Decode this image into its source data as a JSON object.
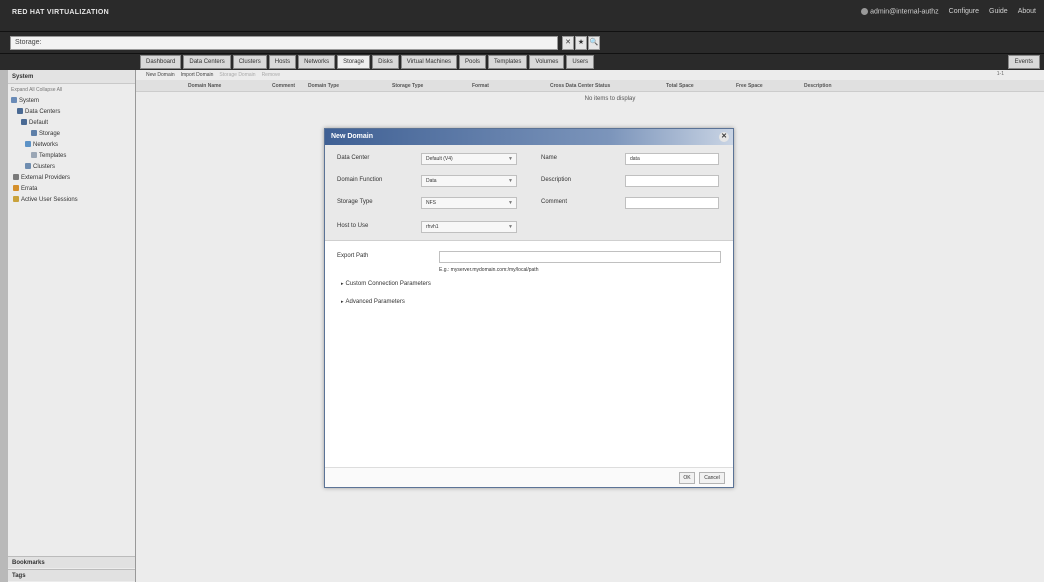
{
  "app": {
    "brand": "RED HAT VIRTUALIZATION",
    "user_label": "admin@internal-authz",
    "top_links": [
      "Configure",
      "Guide",
      "About"
    ]
  },
  "search": {
    "value": "Storage:",
    "buttons": [
      "✕",
      "★",
      "🔍"
    ]
  },
  "tabs": [
    {
      "label": "Dashboard",
      "active": false
    },
    {
      "label": "Data Centers",
      "active": false
    },
    {
      "label": "Clusters",
      "active": false
    },
    {
      "label": "Hosts",
      "active": false
    },
    {
      "label": "Networks",
      "active": false
    },
    {
      "label": "Storage",
      "active": true
    },
    {
      "label": "Disks",
      "active": false
    },
    {
      "label": "Virtual Machines",
      "active": false
    },
    {
      "label": "Pools",
      "active": false
    },
    {
      "label": "Templates",
      "active": false
    },
    {
      "label": "Volumes",
      "active": false
    },
    {
      "label": "Users",
      "active": false
    }
  ],
  "events_tab": "Events",
  "sidebar": {
    "title": "System",
    "expand_all": "Expand All",
    "collapse_all": "Collapse All",
    "tree": [
      {
        "label": "System",
        "icon": "globe-icon"
      },
      {
        "label": "Data Centers",
        "icon": "datacenter-icon"
      },
      {
        "label": "Default",
        "icon": "datacenter-icon"
      },
      {
        "label": "Storage",
        "icon": "storage-icon"
      },
      {
        "label": "Networks",
        "icon": "network-icon"
      },
      {
        "label": "Templates",
        "icon": "template-icon"
      },
      {
        "label": "Clusters",
        "icon": "cluster-icon"
      },
      {
        "label": "External Providers",
        "icon": "provider-icon"
      },
      {
        "label": "Errata",
        "icon": "errata-icon"
      },
      {
        "label": "Active User Sessions",
        "icon": "user-icon"
      }
    ],
    "bookmarks": "Bookmarks",
    "tags": "Tags"
  },
  "actions": {
    "new_domain": "New Domain",
    "import_domain": "Import Domain",
    "storage_domain": "Storage Domain",
    "remove": "Remove",
    "pager": "1-1"
  },
  "columns": [
    "Domain Name",
    "Comment",
    "Domain Type",
    "Storage Type",
    "Format",
    "Cross Data Center Status",
    "Total Space",
    "Free Space",
    "Description"
  ],
  "empty_message": "No items to display",
  "dialog": {
    "title": "New Domain",
    "labels": {
      "data_center": "Data Center",
      "domain_function": "Domain Function",
      "storage_type": "Storage Type",
      "host_to_use": "Host to Use",
      "name": "Name",
      "description": "Description",
      "comment": "Comment",
      "export_path": "Export Path"
    },
    "values": {
      "data_center": "Default (V4)",
      "domain_function": "Data",
      "storage_type": "NFS",
      "host_to_use": "rhvh1",
      "name": "data",
      "description": "",
      "comment": "",
      "export_path": ""
    },
    "export_hint": "E.g.: myserver.mydomain.com:/my/local/path",
    "custom_connection": "Custom Connection Parameters",
    "advanced": "Advanced Parameters",
    "ok": "OK",
    "cancel": "Cancel"
  }
}
